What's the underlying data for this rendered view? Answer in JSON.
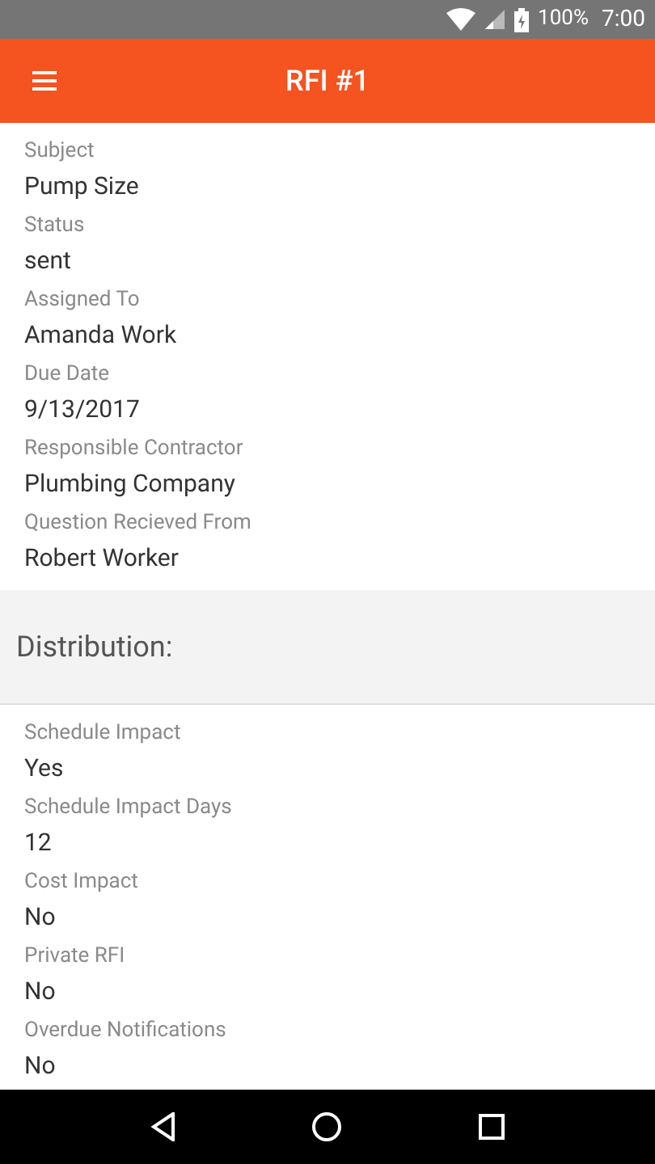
{
  "status_bar": {
    "battery": "100%",
    "time": "7:00"
  },
  "app_bar": {
    "title": "RFI #1"
  },
  "details": [
    {
      "label": "Subject",
      "value": "Pump Size"
    },
    {
      "label": "Status",
      "value": "sent"
    },
    {
      "label": "Assigned To",
      "value": "Amanda Work"
    },
    {
      "label": "Due Date",
      "value": "9/13/2017"
    },
    {
      "label": "Responsible Contractor",
      "value": "Plumbing Company"
    },
    {
      "label": "Question Recieved From",
      "value": "Robert Worker"
    }
  ],
  "section_header": "Distribution:",
  "distribution": [
    {
      "label": "Schedule Impact",
      "value": "Yes"
    },
    {
      "label": "Schedule Impact Days",
      "value": "12"
    },
    {
      "label": "Cost Impact",
      "value": "No"
    },
    {
      "label": "Private RFI",
      "value": "No"
    },
    {
      "label": "Overdue Notifications",
      "value": "No"
    }
  ]
}
